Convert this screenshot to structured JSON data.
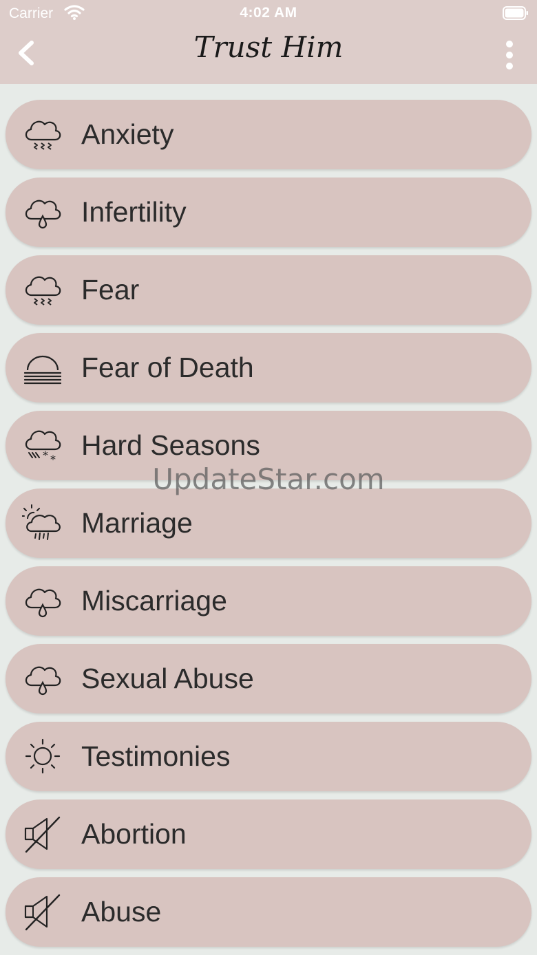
{
  "status_bar": {
    "carrier": "Carrier",
    "time": "4:02 AM"
  },
  "nav": {
    "title": "Trust Him"
  },
  "topics": [
    {
      "label": "Anxiety",
      "icon": "cloud-rain-icon"
    },
    {
      "label": "Infertility",
      "icon": "cloud-drop-icon"
    },
    {
      "label": "Fear",
      "icon": "cloud-rain-icon"
    },
    {
      "label": "Fear of Death",
      "icon": "fog-icon"
    },
    {
      "label": "Hard Seasons",
      "icon": "cloud-snow-icon"
    },
    {
      "label": "Marriage",
      "icon": "sun-cloud-rain-icon"
    },
    {
      "label": "Miscarriage",
      "icon": "cloud-drop-icon"
    },
    {
      "label": "Sexual Abuse",
      "icon": "cloud-drop-icon"
    },
    {
      "label": "Testimonies",
      "icon": "sun-icon"
    },
    {
      "label": "Abortion",
      "icon": "speaker-muted-icon"
    },
    {
      "label": "Abuse",
      "icon": "speaker-muted-icon"
    }
  ],
  "watermark": "UpdateStar.com"
}
